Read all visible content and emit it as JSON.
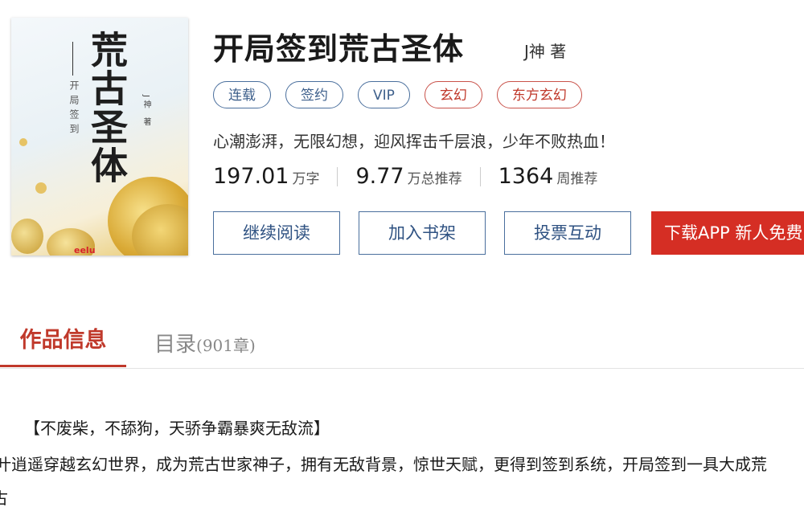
{
  "book": {
    "cover": {
      "title_vertical": "荒古圣体",
      "subtitle_vertical": "开局签到",
      "author_vertical": "J神 著",
      "logo": "eelu"
    },
    "title": "开局签到荒古圣体",
    "author": "J神 著",
    "tags": [
      {
        "label": "连载",
        "style": "blue"
      },
      {
        "label": "签约",
        "style": "blue"
      },
      {
        "label": "VIP",
        "style": "blue"
      },
      {
        "label": "玄幻",
        "style": "red"
      },
      {
        "label": "东方玄幻",
        "style": "red"
      }
    ],
    "slogan": "心潮澎湃，无限幻想，迎风挥击千层浪，少年不败热血！",
    "stats": [
      {
        "value": "197.01",
        "unit": "万字"
      },
      {
        "value": "9.77",
        "unit": "万总推荐"
      },
      {
        "value": "1364",
        "unit": "周推荐"
      }
    ],
    "actions": {
      "continue_reading": "继续阅读",
      "add_to_shelf": "加入书架",
      "vote": "投票互动",
      "download": "下载APP 新人免费"
    }
  },
  "tabs": {
    "info": "作品信息",
    "catalog": "目录",
    "catalog_count": "(901章)"
  },
  "intro": {
    "headline": "【不废柴，不舔狗，天骄争霸暴爽无敌流】",
    "line1": "叶逍遥穿越玄幻世界，成为荒古世家神子，拥有无敌背景，惊世天赋，更得到签到系统，开局签到一具大成荒",
    "line2": "古"
  },
  "colors": {
    "accent_red": "#c0392b",
    "button_blue": "#4a6f9d",
    "download_red": "#d52e24"
  }
}
